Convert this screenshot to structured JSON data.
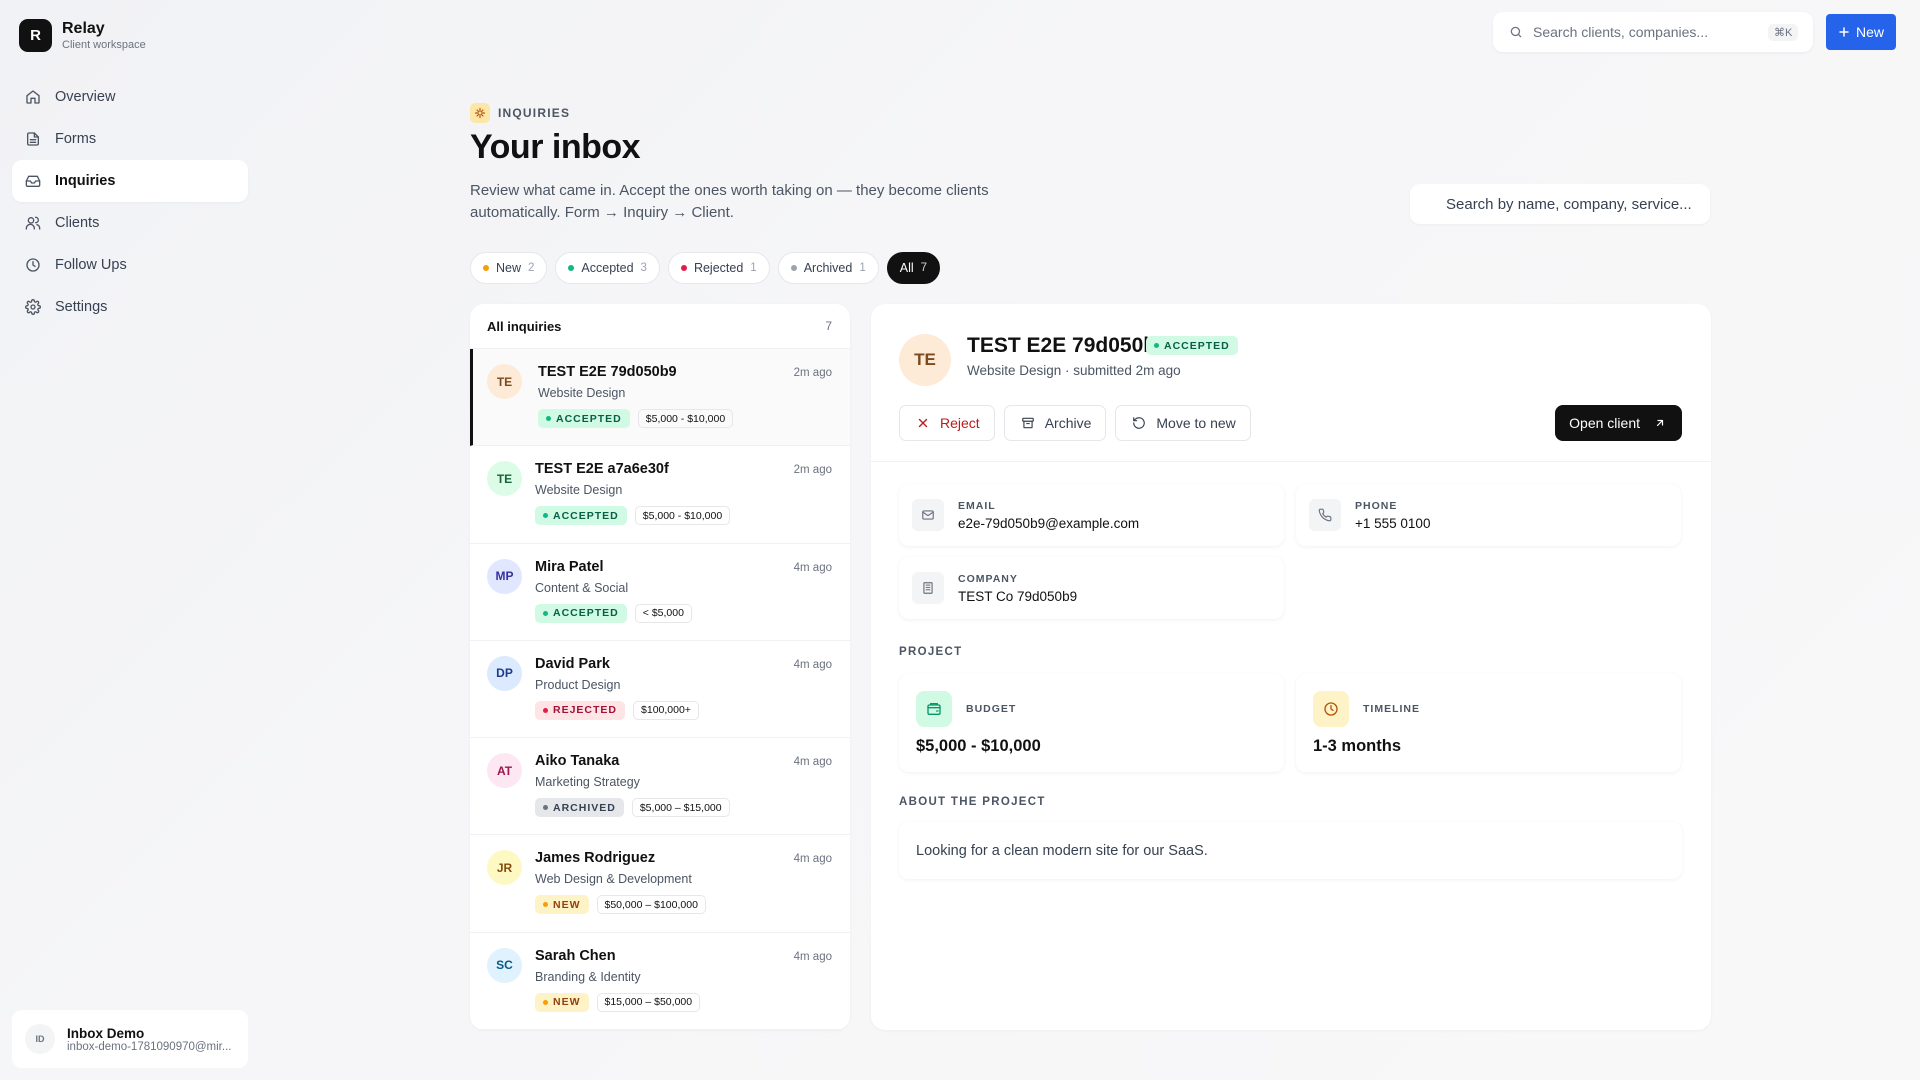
{
  "brand": {
    "logo_letter": "R",
    "name": "Relay",
    "subtitle": "Client workspace"
  },
  "sidebar": {
    "items": [
      {
        "label": "Overview",
        "icon": "home-icon"
      },
      {
        "label": "Forms",
        "icon": "file-icon"
      },
      {
        "label": "Inquiries",
        "icon": "inbox-icon",
        "active": true
      },
      {
        "label": "Clients",
        "icon": "users-icon"
      },
      {
        "label": "Follow Ups",
        "icon": "clock-icon"
      },
      {
        "label": "Settings",
        "icon": "gear-icon"
      }
    ],
    "user": {
      "initials": "ID",
      "name": "Inbox Demo",
      "email": "inbox-demo-1781090970@mir..."
    }
  },
  "topbar": {
    "search_placeholder": "Search clients, companies...",
    "shortcut": "⌘K",
    "new_label": "New",
    "accent": "#2563eb"
  },
  "header": {
    "eyebrow": "INQUIRIES",
    "title": "Your inbox",
    "description": "Review what came in. Accept the ones worth taking on — they become clients automatically. Form → Inquiry → Client.",
    "search_placeholder": "Search by name, company, service..."
  },
  "filters": [
    {
      "label": "New",
      "count": "2",
      "color": "#f59e0b"
    },
    {
      "label": "Accepted",
      "count": "3",
      "color": "#10b981"
    },
    {
      "label": "Rejected",
      "count": "1",
      "color": "#e11d48"
    },
    {
      "label": "Archived",
      "count": "1",
      "color": "#9ca3af"
    },
    {
      "label": "All",
      "count": "7",
      "active": true
    }
  ],
  "list": {
    "title": "All inquiries",
    "count": "7",
    "rows": [
      {
        "initials": "TE",
        "name": "TEST E2E 79d050b9",
        "service": "Website Design",
        "time": "2m ago",
        "status": "ACCEPTED",
        "budget": "$5,000 - $10,000",
        "avatar_bg": "#fdebd7",
        "avatar_fg": "#7c4a1e",
        "selected": true
      },
      {
        "initials": "TE",
        "name": "TEST E2E a7a6e30f",
        "service": "Website Design",
        "time": "2m ago",
        "status": "ACCEPTED",
        "budget": "$5,000 - $10,000",
        "avatar_bg": "#dcfce7",
        "avatar_fg": "#166534"
      },
      {
        "initials": "MP",
        "name": "Mira Patel",
        "service": "Content & Social",
        "time": "4m ago",
        "status": "ACCEPTED",
        "budget": "< $5,000",
        "avatar_bg": "#e0e7ff",
        "avatar_fg": "#3730a3"
      },
      {
        "initials": "DP",
        "name": "David Park",
        "service": "Product Design",
        "time": "4m ago",
        "status": "REJECTED",
        "budget": "$100,000+",
        "avatar_bg": "#dbeafe",
        "avatar_fg": "#1e3a8a"
      },
      {
        "initials": "AT",
        "name": "Aiko Tanaka",
        "service": "Marketing Strategy",
        "time": "4m ago",
        "status": "ARCHIVED",
        "budget": "$5,000 – $15,000",
        "avatar_bg": "#fce7f3",
        "avatar_fg": "#9d174d"
      },
      {
        "initials": "JR",
        "name": "James Rodriguez",
        "service": "Web Design & Development",
        "time": "4m ago",
        "status": "NEW",
        "budget": "$50,000 – $100,000",
        "avatar_bg": "#fef9c3",
        "avatar_fg": "#854d0e"
      },
      {
        "initials": "SC",
        "name": "Sarah Chen",
        "service": "Branding & Identity",
        "time": "4m ago",
        "status": "NEW",
        "budget": "$15,000 – $50,000",
        "avatar_bg": "#e0f2fe",
        "avatar_fg": "#075985"
      }
    ]
  },
  "status_styles": {
    "ACCEPTED": {
      "bg": "#d1fae5",
      "fg": "#065f46",
      "dot": "#10b981"
    },
    "REJECTED": {
      "bg": "#ffe4e6",
      "fg": "#9f1239",
      "dot": "#e11d48"
    },
    "ARCHIVED": {
      "bg": "#e5e7eb",
      "fg": "#374151",
      "dot": "#6b7280"
    },
    "NEW": {
      "bg": "#fef3c7",
      "fg": "#92400e",
      "dot": "#f59e0b"
    }
  },
  "detail": {
    "initials": "TE",
    "name": "TEST E2E 79d050b9",
    "status": "ACCEPTED",
    "subtitle": "Website Design · submitted 2m ago",
    "actions": {
      "reject": "Reject",
      "archive": "Archive",
      "move": "Move to new",
      "open": "Open client"
    },
    "email_label": "EMAIL",
    "email": "e2e-79d050b9@example.com",
    "phone_label": "PHONE",
    "phone": "+1 555 0100",
    "company_label": "COMPANY",
    "company": "TEST Co 79d050b9",
    "project_label": "PROJECT",
    "budget_label": "BUDGET",
    "budget": "$5,000 - $10,000",
    "timeline_label": "TIMELINE",
    "timeline": "1-3 months",
    "about_label": "ABOUT THE PROJECT",
    "about": "Looking for a clean modern site for our SaaS."
  }
}
